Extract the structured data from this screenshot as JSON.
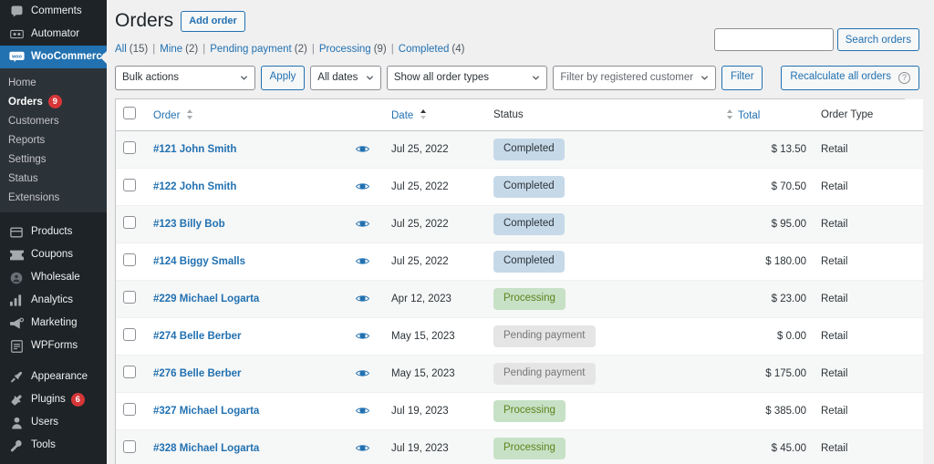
{
  "sidebar": {
    "items": [
      {
        "label": "Comments",
        "icon": "comments-icon",
        "id": "comments"
      },
      {
        "label": "Automator",
        "icon": "automator-icon",
        "id": "automator"
      },
      {
        "label": "WooCommerce",
        "icon": "woocommerce-icon",
        "id": "woocommerce",
        "current": true
      }
    ],
    "submenu": [
      {
        "label": "Home",
        "id": "home"
      },
      {
        "label": "Orders",
        "id": "orders",
        "active": true,
        "count": "9"
      },
      {
        "label": "Customers",
        "id": "customers"
      },
      {
        "label": "Reports",
        "id": "reports"
      },
      {
        "label": "Settings",
        "id": "settings"
      },
      {
        "label": "Status",
        "id": "status"
      },
      {
        "label": "Extensions",
        "id": "extensions"
      }
    ],
    "items_group2": [
      {
        "label": "Products",
        "icon": "products-icon",
        "id": "products"
      },
      {
        "label": "Coupons",
        "icon": "coupons-icon",
        "id": "coupons"
      },
      {
        "label": "Wholesale",
        "icon": "wholesale-icon",
        "id": "wholesale"
      },
      {
        "label": "Analytics",
        "icon": "analytics-icon",
        "id": "analytics"
      },
      {
        "label": "Marketing",
        "icon": "marketing-icon",
        "id": "marketing"
      },
      {
        "label": "WPForms",
        "icon": "wpforms-icon",
        "id": "wpforms"
      }
    ],
    "items_group3": [
      {
        "label": "Appearance",
        "icon": "appearance-icon",
        "id": "appearance"
      },
      {
        "label": "Plugins",
        "icon": "plugins-icon",
        "id": "plugins",
        "count": "6"
      },
      {
        "label": "Users",
        "icon": "users-icon",
        "id": "users"
      }
    ],
    "accent_current": "#2271b1",
    "badge_color": "#d63638"
  },
  "header": {
    "title": "Orders",
    "add_order_label": "Add order"
  },
  "filter_links": [
    {
      "label": "All",
      "count": "(15)"
    },
    {
      "label": "Mine",
      "count": "(2)"
    },
    {
      "label": "Pending payment",
      "count": "(2)"
    },
    {
      "label": "Processing",
      "count": "(9)"
    },
    {
      "label": "Completed",
      "count": "(4)"
    }
  ],
  "toolbar": {
    "bulk_actions": "Bulk actions",
    "apply_label": "Apply",
    "all_dates": "All dates",
    "order_types": "Show all order types",
    "filter_customer": "Filter by registered customer",
    "filter_label": "Filter",
    "recalculate_label": "Recalculate all orders",
    "help_glyph": "?"
  },
  "search": {
    "value": "",
    "placeholder": "",
    "button_label": "Search orders"
  },
  "table": {
    "columns": {
      "order": "Order",
      "date": "Date",
      "status": "Status",
      "total": "Total",
      "order_type": "Order Type"
    },
    "rows": [
      {
        "order": "#121 John Smith",
        "date": "Jul 25, 2022",
        "status": "Completed",
        "status_key": "completed",
        "total": "$ 13.50",
        "type": "Retail"
      },
      {
        "order": "#122 John Smith",
        "date": "Jul 25, 2022",
        "status": "Completed",
        "status_key": "completed",
        "total": "$ 70.50",
        "type": "Retail"
      },
      {
        "order": "#123 Billy Bob",
        "date": "Jul 25, 2022",
        "status": "Completed",
        "status_key": "completed",
        "total": "$ 95.00",
        "type": "Retail"
      },
      {
        "order": "#124 Biggy Smalls",
        "date": "Jul 25, 2022",
        "status": "Completed",
        "status_key": "completed",
        "total": "$ 180.00",
        "type": "Retail"
      },
      {
        "order": "#229 Michael Logarta",
        "date": "Apr 12, 2023",
        "status": "Processing",
        "status_key": "processing",
        "total": "$ 23.00",
        "type": "Retail"
      },
      {
        "order": "#274 Belle Berber",
        "date": "May 15, 2023",
        "status": "Pending payment",
        "status_key": "pending",
        "total": "$ 0.00",
        "type": "Retail"
      },
      {
        "order": "#276 Belle Berber",
        "date": "May 15, 2023",
        "status": "Pending payment",
        "status_key": "pending",
        "total": "$ 175.00",
        "type": "Retail"
      },
      {
        "order": "#327 Michael Logarta",
        "date": "Jul 19, 2023",
        "status": "Processing",
        "status_key": "processing",
        "total": "$ 385.00",
        "type": "Retail"
      },
      {
        "order": "#328 Michael Logarta",
        "date": "Jul 19, 2023",
        "status": "Processing",
        "status_key": "processing",
        "total": "$ 45.00",
        "type": "Retail"
      }
    ]
  },
  "colors": {
    "link": "#2271b1",
    "status_completed_bg": "#c6d9e9",
    "status_processing_bg": "#c6e1c6",
    "status_pending_bg": "#e5e5e5",
    "sidebar_bg": "#1d2327"
  }
}
